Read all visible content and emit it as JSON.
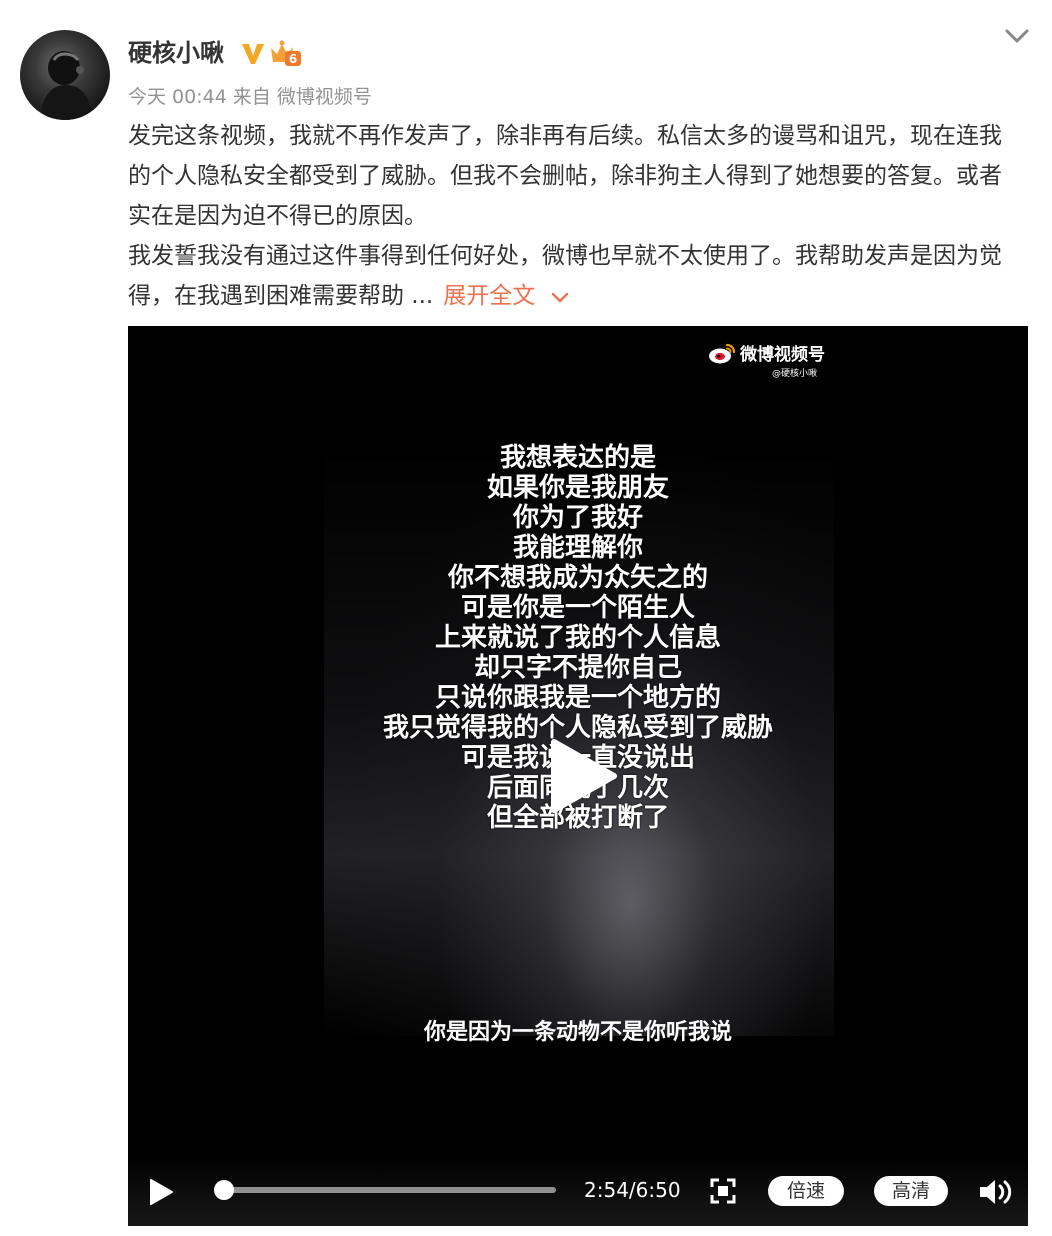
{
  "user": {
    "name": "硬核小啾",
    "badge_v": "V",
    "badge_level": "6"
  },
  "meta": {
    "time": "今天 00:44",
    "source_prefix": "来自",
    "source": "微博视频号"
  },
  "post": {
    "paragraph1": "发完这条视频，我就不再作发声了，除非再有后续。私信太多的谩骂和诅咒，现在连我的个人隐私安全都受到了威胁。但我不会删帖，除非狗主人得到了她想要的答复。或者实在是因为迫不得已的原因。",
    "paragraph2": "我发誓我没有通过这件事得到任何好处，微博也早就不太使用了。我帮助发声是因为觉得，在我遇到困难需要帮助 ...",
    "expand_label": "展开全文"
  },
  "video": {
    "watermark_title": "微博视频号",
    "watermark_handle": "@硬核小啾",
    "lines": [
      "我想表达的是",
      "如果你是我朋友",
      "你为了我好",
      "我能理解你",
      "你不想我成为众矢之的",
      "可是你是一个陌生人",
      "上来就说了我的个人信息",
      "却只字不提你自己",
      "只说你跟我是一个地方的",
      "我只觉得我的个人隐私受到了威胁",
      "可是我说一直没说出",
      "后面同说了几次",
      "但全部被打断了"
    ],
    "subtitle": "你是因为一条动物不是你听我说",
    "controls": {
      "time": "2:54/6:50",
      "progress_fraction": 0.03,
      "speed_label": "倍速",
      "quality_label": "高清"
    }
  },
  "icons": {
    "chevron": "chevron-down-icon",
    "play": "play-icon",
    "fullscreen": "fullscreen-icon",
    "volume": "volume-icon",
    "weibo": "weibo-logo-icon"
  },
  "colors": {
    "link": "#eb7350",
    "meta": "#939393",
    "vip_gold": "#f5a623",
    "level_badge": "#f5a13a"
  }
}
